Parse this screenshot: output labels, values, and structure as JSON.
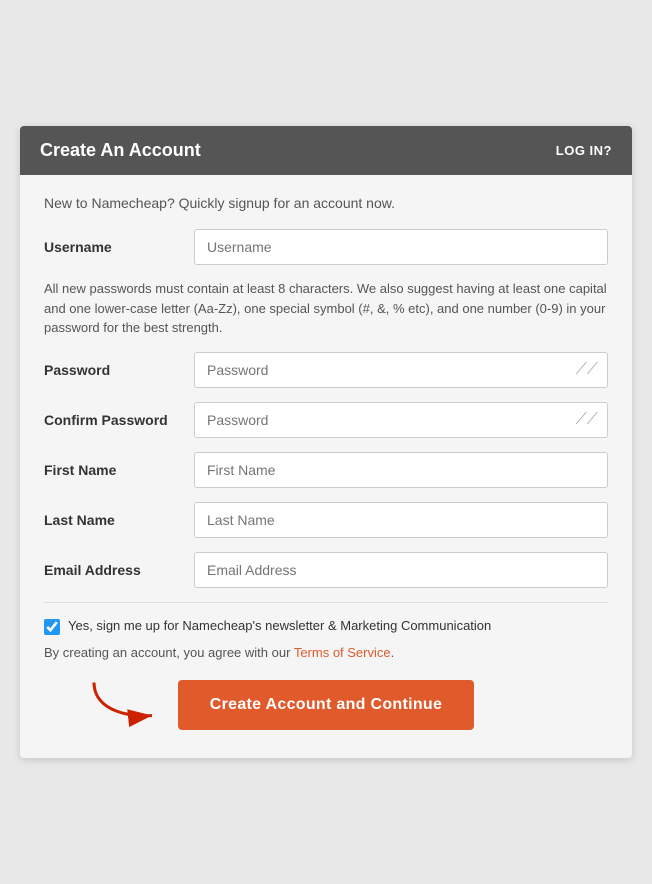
{
  "header": {
    "title": "Create An Account",
    "login_label": "LOG IN?"
  },
  "intro": {
    "text": "New to Namecheap? Quickly signup for an account now."
  },
  "password_hint": {
    "text": "All new passwords must contain at least 8 characters. We also suggest having at least one capital and one lower-case letter (Aa-Zz), one special symbol (#, &, % etc), and one number (0-9) in your password for the best strength."
  },
  "form": {
    "username_label": "Username",
    "username_placeholder": "Username",
    "password_label": "Password",
    "password_placeholder": "Password",
    "confirm_password_label": "Confirm Password",
    "confirm_password_placeholder": "Password",
    "first_name_label": "First Name",
    "first_name_placeholder": "First Name",
    "last_name_label": "Last Name",
    "last_name_placeholder": "Last Name",
    "email_label": "Email Address",
    "email_placeholder": "Email Address"
  },
  "newsletter": {
    "label": "Yes, sign me up for Namecheap's newsletter & Marketing Communication"
  },
  "terms": {
    "text": "By creating an account, you agree with our ",
    "link_text": "Terms of Service",
    "period": "."
  },
  "submit": {
    "label": "Create Account and Continue"
  },
  "icons": {
    "eye_slash": "⟋⟋",
    "arrow": "→"
  }
}
